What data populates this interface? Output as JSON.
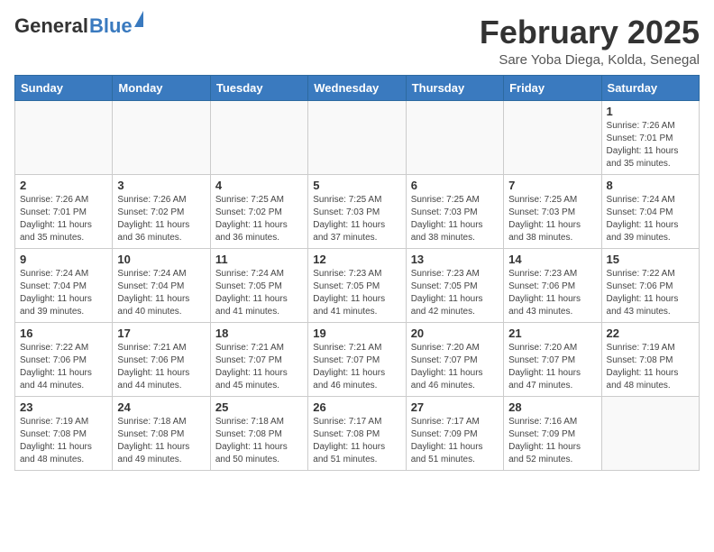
{
  "header": {
    "logo_general": "General",
    "logo_blue": "Blue",
    "month_title": "February 2025",
    "location": "Sare Yoba Diega, Kolda, Senegal"
  },
  "days_of_week": [
    "Sunday",
    "Monday",
    "Tuesday",
    "Wednesday",
    "Thursday",
    "Friday",
    "Saturday"
  ],
  "weeks": [
    [
      {
        "day": "",
        "info": ""
      },
      {
        "day": "",
        "info": ""
      },
      {
        "day": "",
        "info": ""
      },
      {
        "day": "",
        "info": ""
      },
      {
        "day": "",
        "info": ""
      },
      {
        "day": "",
        "info": ""
      },
      {
        "day": "1",
        "info": "Sunrise: 7:26 AM\nSunset: 7:01 PM\nDaylight: 11 hours\nand 35 minutes."
      }
    ],
    [
      {
        "day": "2",
        "info": "Sunrise: 7:26 AM\nSunset: 7:01 PM\nDaylight: 11 hours\nand 35 minutes."
      },
      {
        "day": "3",
        "info": "Sunrise: 7:26 AM\nSunset: 7:02 PM\nDaylight: 11 hours\nand 36 minutes."
      },
      {
        "day": "4",
        "info": "Sunrise: 7:25 AM\nSunset: 7:02 PM\nDaylight: 11 hours\nand 36 minutes."
      },
      {
        "day": "5",
        "info": "Sunrise: 7:25 AM\nSunset: 7:03 PM\nDaylight: 11 hours\nand 37 minutes."
      },
      {
        "day": "6",
        "info": "Sunrise: 7:25 AM\nSunset: 7:03 PM\nDaylight: 11 hours\nand 38 minutes."
      },
      {
        "day": "7",
        "info": "Sunrise: 7:25 AM\nSunset: 7:03 PM\nDaylight: 11 hours\nand 38 minutes."
      },
      {
        "day": "8",
        "info": "Sunrise: 7:24 AM\nSunset: 7:04 PM\nDaylight: 11 hours\nand 39 minutes."
      }
    ],
    [
      {
        "day": "9",
        "info": "Sunrise: 7:24 AM\nSunset: 7:04 PM\nDaylight: 11 hours\nand 39 minutes."
      },
      {
        "day": "10",
        "info": "Sunrise: 7:24 AM\nSunset: 7:04 PM\nDaylight: 11 hours\nand 40 minutes."
      },
      {
        "day": "11",
        "info": "Sunrise: 7:24 AM\nSunset: 7:05 PM\nDaylight: 11 hours\nand 41 minutes."
      },
      {
        "day": "12",
        "info": "Sunrise: 7:23 AM\nSunset: 7:05 PM\nDaylight: 11 hours\nand 41 minutes."
      },
      {
        "day": "13",
        "info": "Sunrise: 7:23 AM\nSunset: 7:05 PM\nDaylight: 11 hours\nand 42 minutes."
      },
      {
        "day": "14",
        "info": "Sunrise: 7:23 AM\nSunset: 7:06 PM\nDaylight: 11 hours\nand 43 minutes."
      },
      {
        "day": "15",
        "info": "Sunrise: 7:22 AM\nSunset: 7:06 PM\nDaylight: 11 hours\nand 43 minutes."
      }
    ],
    [
      {
        "day": "16",
        "info": "Sunrise: 7:22 AM\nSunset: 7:06 PM\nDaylight: 11 hours\nand 44 minutes."
      },
      {
        "day": "17",
        "info": "Sunrise: 7:21 AM\nSunset: 7:06 PM\nDaylight: 11 hours\nand 44 minutes."
      },
      {
        "day": "18",
        "info": "Sunrise: 7:21 AM\nSunset: 7:07 PM\nDaylight: 11 hours\nand 45 minutes."
      },
      {
        "day": "19",
        "info": "Sunrise: 7:21 AM\nSunset: 7:07 PM\nDaylight: 11 hours\nand 46 minutes."
      },
      {
        "day": "20",
        "info": "Sunrise: 7:20 AM\nSunset: 7:07 PM\nDaylight: 11 hours\nand 46 minutes."
      },
      {
        "day": "21",
        "info": "Sunrise: 7:20 AM\nSunset: 7:07 PM\nDaylight: 11 hours\nand 47 minutes."
      },
      {
        "day": "22",
        "info": "Sunrise: 7:19 AM\nSunset: 7:08 PM\nDaylight: 11 hours\nand 48 minutes."
      }
    ],
    [
      {
        "day": "23",
        "info": "Sunrise: 7:19 AM\nSunset: 7:08 PM\nDaylight: 11 hours\nand 48 minutes."
      },
      {
        "day": "24",
        "info": "Sunrise: 7:18 AM\nSunset: 7:08 PM\nDaylight: 11 hours\nand 49 minutes."
      },
      {
        "day": "25",
        "info": "Sunrise: 7:18 AM\nSunset: 7:08 PM\nDaylight: 11 hours\nand 50 minutes."
      },
      {
        "day": "26",
        "info": "Sunrise: 7:17 AM\nSunset: 7:08 PM\nDaylight: 11 hours\nand 51 minutes."
      },
      {
        "day": "27",
        "info": "Sunrise: 7:17 AM\nSunset: 7:09 PM\nDaylight: 11 hours\nand 51 minutes."
      },
      {
        "day": "28",
        "info": "Sunrise: 7:16 AM\nSunset: 7:09 PM\nDaylight: 11 hours\nand 52 minutes."
      },
      {
        "day": "",
        "info": ""
      }
    ]
  ]
}
